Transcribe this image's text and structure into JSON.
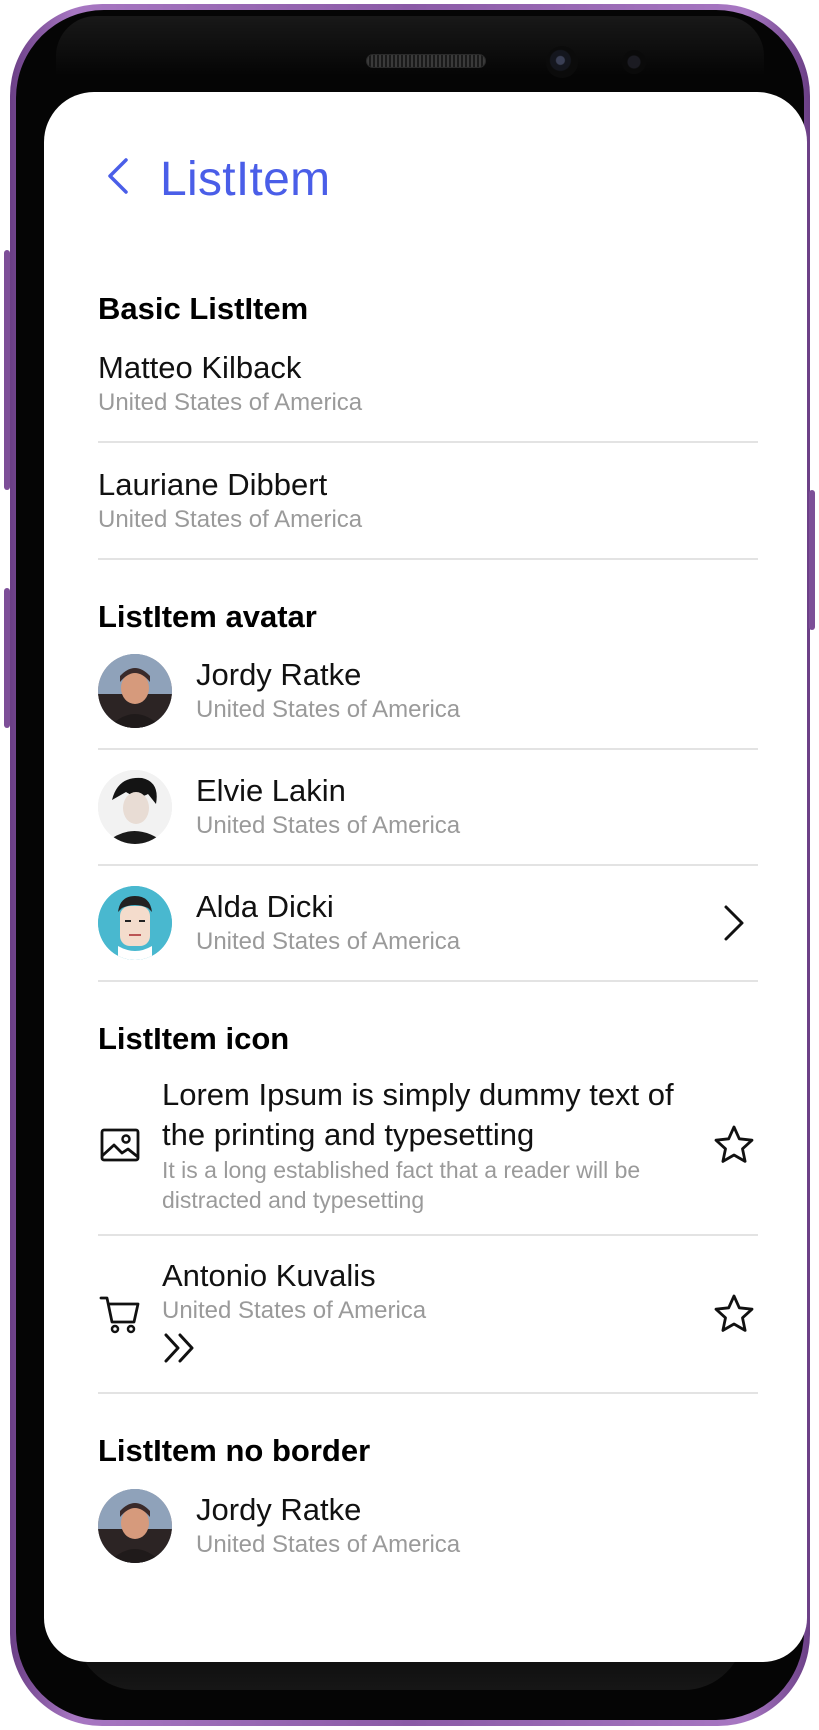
{
  "header": {
    "title": "ListItem"
  },
  "sections": {
    "basic": {
      "title": "Basic ListItem",
      "items": [
        {
          "name": "Matteo Kilback",
          "subtitle": "United States of America"
        },
        {
          "name": "Lauriane Dibbert",
          "subtitle": "United States of America"
        }
      ]
    },
    "avatar": {
      "title": "ListItem avatar",
      "items": [
        {
          "name": "Jordy Ratke",
          "subtitle": "United States of America"
        },
        {
          "name": "Elvie Lakin",
          "subtitle": "United States of America"
        },
        {
          "name": "Alda Dicki",
          "subtitle": "United States of America"
        }
      ]
    },
    "icon": {
      "title": "ListItem icon",
      "items": [
        {
          "name": "Lorem Ipsum is simply dummy text of the printing and typesetting",
          "subtitle": "It is a long established fact that a reader will be distracted and typesetting",
          "left_icon": "image-icon",
          "right_icon": "star-icon"
        },
        {
          "name": "Antonio Kuvalis",
          "subtitle": "United States of America",
          "left_icon": "cart-icon",
          "extra_icon": "double-chevron-right-icon",
          "right_icon": "star-icon"
        }
      ]
    },
    "noborder": {
      "title": "ListItem no border",
      "items": [
        {
          "name": "Jordy Ratke",
          "subtitle": "United States of America"
        }
      ]
    }
  },
  "colors": {
    "accent": "#4a5ee8",
    "subtitle": "#9a9a9a",
    "divider": "#e3e3e3",
    "frame": "#8a5aa6"
  }
}
